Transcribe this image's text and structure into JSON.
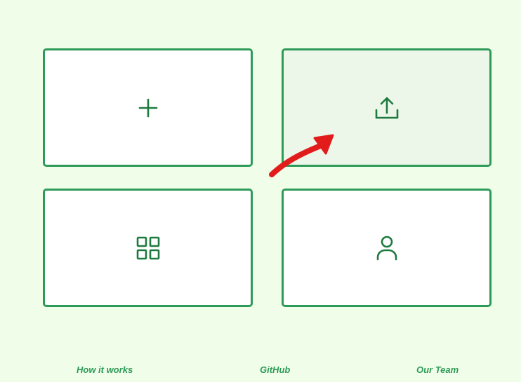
{
  "cards": [
    {
      "icon": "plus-icon",
      "action": "create"
    },
    {
      "icon": "upload-icon",
      "action": "upload",
      "highlighted": true
    },
    {
      "icon": "grid-icon",
      "action": "browse"
    },
    {
      "icon": "user-icon",
      "action": "profile"
    }
  ],
  "annotation": {
    "type": "arrow",
    "color": "#e21b1b",
    "points_to": "upload-card"
  },
  "footer": {
    "how_it_works": "How it works",
    "github": "GitHub",
    "our_team": "Our Team"
  },
  "colors": {
    "background": "#f0fee9",
    "accent": "#2e9a57",
    "icon": "#1f7a3f",
    "card": "#ffffff",
    "card_highlight": "#ecf7ea"
  }
}
